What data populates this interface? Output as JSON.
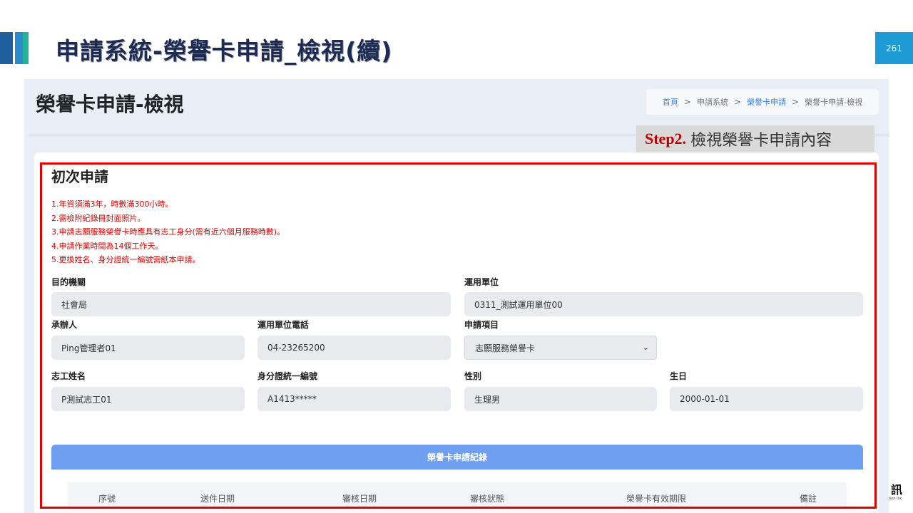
{
  "slide": {
    "title": "申請系統-榮譽卡申請_檢視(續)",
    "page_number": "261"
  },
  "screen": {
    "title": "榮譽卡申請-檢視",
    "breadcrumb": {
      "home": "首頁",
      "system": "申請系統",
      "card": "榮譽卡申請",
      "current": "榮譽卡申請-檢視",
      "separator": ">"
    }
  },
  "callout": {
    "step": "Step2.",
    "text": "檢視榮譽卡申請內容"
  },
  "form": {
    "section_title": "初次申請",
    "notes": [
      "1.年資須滿3年，時數滿300小時。",
      "2.需檢附紀錄冊封面照片。",
      "3.申請志願服務榮譽卡時應具有志工身分(需有近六個月服務時數)。",
      "4.申請作業時間為14個工作天。",
      "5.更換姓名、身分證統一編號需紙本申請。"
    ],
    "fields": {
      "agency": {
        "label": "目的機關",
        "value": "社會局"
      },
      "unit": {
        "label": "運用單位",
        "value": "0311_測試運用單位00"
      },
      "handler": {
        "label": "承辦人",
        "value": "Ping管理者01"
      },
      "unit_phone": {
        "label": "運用單位電話",
        "value": "04-23265200"
      },
      "item": {
        "label": "申請項目",
        "value": "志願服務榮譽卡"
      },
      "volunteer_name": {
        "label": "志工姓名",
        "value": "P測試志工01"
      },
      "id_number": {
        "label": "身分證統一編號",
        "value": "A1413*****"
      },
      "gender": {
        "label": "性別",
        "value": "生理男"
      },
      "birthday": {
        "label": "生日",
        "value": "2000-01-01"
      }
    }
  },
  "records": {
    "title": "榮譽卡申請紀錄",
    "columns": [
      "序號",
      "送件日期",
      "審核日期",
      "審核狀態",
      "榮譽卡有效期限",
      "備註"
    ]
  },
  "logo": {
    "mark": "訊",
    "sub": "tion Inc."
  }
}
